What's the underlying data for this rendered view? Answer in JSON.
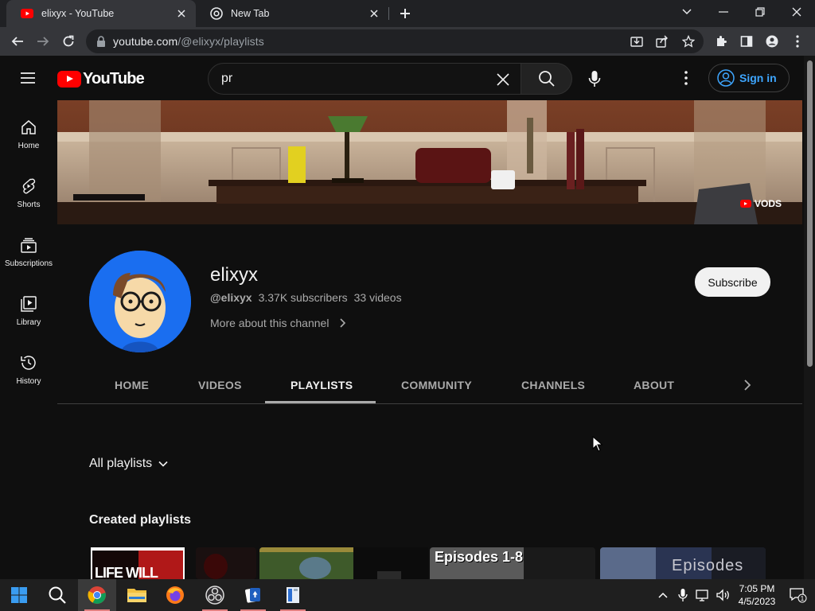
{
  "browser": {
    "tabs": [
      {
        "title": "elixyx - YouTube",
        "active": true
      },
      {
        "title": "New Tab",
        "active": false
      }
    ],
    "url": {
      "host": "youtube.com",
      "path": "/@elixyx/playlists"
    }
  },
  "youtube": {
    "logo_text": "YouTube",
    "search": {
      "query": "pr"
    },
    "signin_label": "Sign in",
    "guide": [
      {
        "label": "Home",
        "icon": "home-icon"
      },
      {
        "label": "Shorts",
        "icon": "shorts-icon"
      },
      {
        "label": "Subscriptions",
        "icon": "subscriptions-icon"
      },
      {
        "label": "Library",
        "icon": "library-icon"
      },
      {
        "label": "History",
        "icon": "history-icon"
      }
    ],
    "banner_badge": "VODS"
  },
  "channel": {
    "name": "elixyx",
    "handle": "@elixyx",
    "subscribers": "3.37K subscribers",
    "videos": "33 videos",
    "about_link": "More about this channel",
    "subscribe_label": "Subscribe",
    "tabs": [
      "HOME",
      "VIDEOS",
      "PLAYLISTS",
      "COMMUNITY",
      "CHANNELS",
      "ABOUT"
    ],
    "active_tab": "PLAYLISTS"
  },
  "playlists": {
    "sort_label": "All playlists",
    "section_title": "Created playlists",
    "thumbnails": [
      {
        "caption": "LIFE WILL"
      },
      {
        "caption": ""
      },
      {
        "caption": "Episodes 1-8"
      },
      {
        "caption": "Episodes"
      }
    ]
  },
  "taskbar": {
    "time": "7:05 PM",
    "date": "4/5/2023",
    "notification_count": "1"
  },
  "colors": {
    "yt_red": "#ff0000",
    "link_blue": "#3ea6ff",
    "background": "#0f0f0f",
    "avatar_blue": "#1a6ef0"
  }
}
